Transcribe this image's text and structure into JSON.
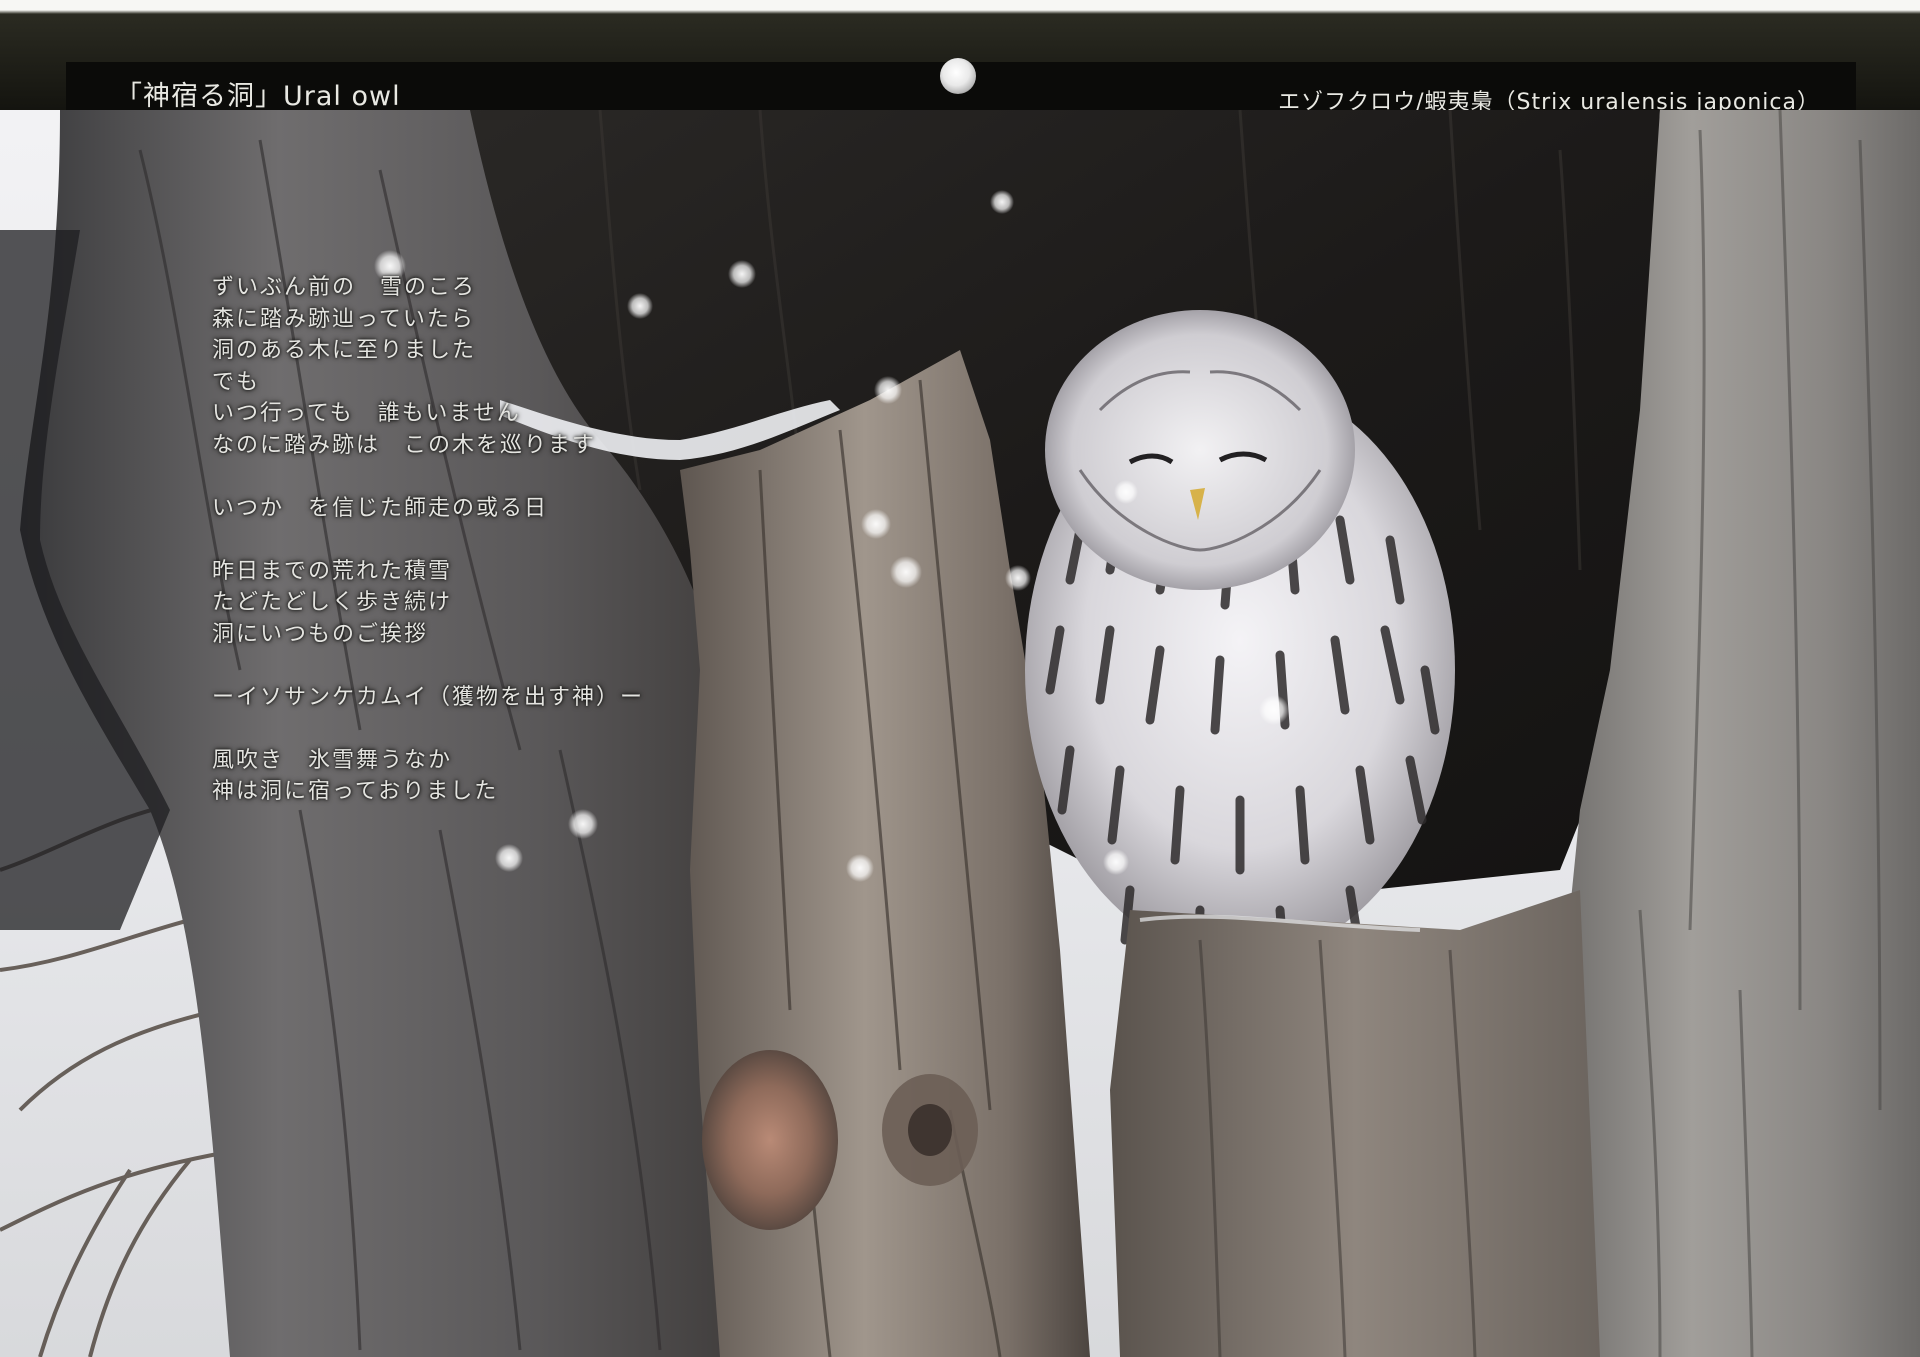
{
  "header": {
    "title_left": "「神宿る洞」Ural owl",
    "title_right": "エゾフクロウ/蝦夷梟（Strix uralensis japonica）"
  },
  "poem": {
    "lines": [
      "ずいぶん前の　雪のころ",
      "森に踏み跡辿っていたら",
      "洞のある木に至りました",
      "でも",
      "いつ行っても　誰もいません",
      "なのに踏み跡は　この木を巡ります",
      "",
      "いつか　を信じた師走の或る日",
      "",
      "昨日までの荒れた積雪",
      "たどたどしく歩き続け",
      "洞にいつものご挨拶",
      "",
      "ーイソサンケカムイ（獲物を出す神）ー",
      "",
      "風吹き　氷雪舞うなか",
      "神は洞に宿っておりました"
    ]
  },
  "colors": {
    "header_bg": "#0b0b09",
    "header_text": "#e8e8e2",
    "poem_text": "#e4e4e0"
  },
  "photo": {
    "subject": "owl-in-tree-hollow-photo"
  }
}
